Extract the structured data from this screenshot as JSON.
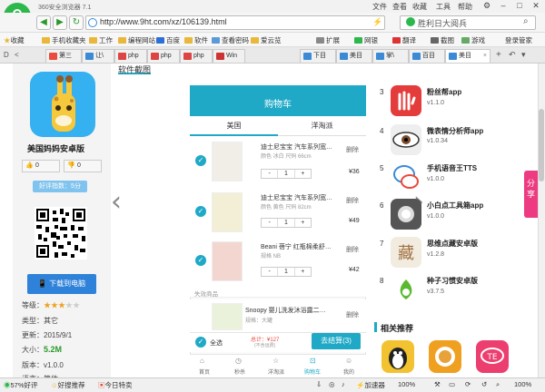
{
  "browser": {
    "title": "360安全浏览器 7.1",
    "menu": [
      "文件",
      "查看",
      "收藏",
      "工具",
      "帮助"
    ],
    "url": "http://www.9ht.com/xz/106139.html",
    "search_value": "胜利日大阅兵",
    "bookmarks": [
      "收藏",
      "手机收藏夹",
      "工作",
      "编程网站",
      "百度",
      "软件",
      "查看密码",
      "爱云览",
      "扩展",
      "网银",
      "翻译",
      "截图",
      "游戏",
      "登录管家"
    ],
    "tabs": [
      "第三",
      "让\\",
      "php",
      "php",
      "php",
      "Win",
      "下目",
      "美目",
      "掌\\",
      "百目",
      "美目"
    ],
    "colors": {
      "accent": "#2db84b",
      "download": "#2f82d9",
      "cart": "#1fa9c6",
      "share": "#ee3a80"
    }
  },
  "status": {
    "good_rate": "57%好评",
    "recommend": "好搜推荐",
    "today": "今日特卖",
    "accelerator": "加速器",
    "zoom_main": "100%",
    "zoom": "100%"
  },
  "app": {
    "section_title": "软件截图",
    "name": "美国妈妈安卓版",
    "like": "0",
    "dislike": "0",
    "good_rate": "好评指数：5分",
    "download": "下载到电脑",
    "level_label": "等级：",
    "type": "类型：其它",
    "updated": "更新：2015/9/1",
    "size_label": "大小：",
    "size_value": "5.2M",
    "version": "版本：v1.0.0",
    "truncated": "语言：简体"
  },
  "phone": {
    "header": "购物车",
    "tab_us": "美国",
    "tab_other": "洋淘派",
    "items": [
      {
        "title": "迪士尼宝宝 汽车系列宽…",
        "sub": "颜色 冰白 尺码 66cm",
        "qty": "1",
        "delete": "删除",
        "price": "¥36"
      },
      {
        "title": "迪士尼宝宝 汽车系列宽…",
        "sub": "颜色 黄色 尺码 82cm",
        "qty": "1",
        "delete": "删除",
        "price": "¥49"
      },
      {
        "title": "Beani 蓓宁 红瓶棉柔舒…",
        "sub": "规格 NB",
        "qty": "1",
        "delete": "删除",
        "price": "¥42"
      }
    ],
    "invalid_label": "失效商品",
    "invalid_item": {
      "title": "Snoopy 婴儿洗发沐浴露二…",
      "sub": "规格：大罐",
      "delete": "删除"
    },
    "select_all": "全选",
    "total_label": "总计：¥127",
    "total_note": "(不含运费)",
    "checkout": "去结算(3)",
    "nav": [
      "首页",
      "秒杀",
      "洋淘派",
      "购物车",
      "我的"
    ]
  },
  "ranking": [
    {
      "rank": "3",
      "name": "粉丝帮app",
      "ver": "v1.1.0"
    },
    {
      "rank": "4",
      "name": "微表情分析师app",
      "ver": "v1.0.34"
    },
    {
      "rank": "5",
      "name": "手机语音王TTS",
      "ver": "v1.0.0"
    },
    {
      "rank": "6",
      "name": "小白点工具箱app",
      "ver": "v1.0.0"
    },
    {
      "rank": "7",
      "name": "思维点藏安卓版",
      "ver": "v1.2.8"
    },
    {
      "rank": "8",
      "name": "种子习惯安卓版",
      "ver": "v3.7.5"
    }
  ],
  "related": {
    "title": "相关推荐"
  },
  "share": "分享"
}
